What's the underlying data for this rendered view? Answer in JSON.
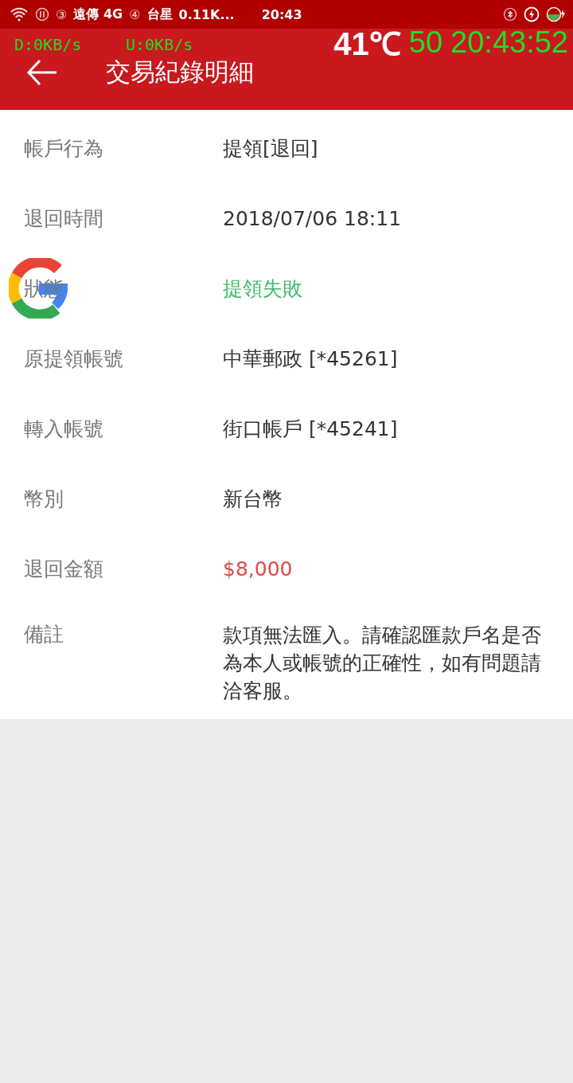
{
  "status_bar": {
    "sim1": "③",
    "carrier1": "遠傳 4G",
    "sim2": "④",
    "carrier2": "台星",
    "speed": "0.11K...",
    "time": "20:43"
  },
  "overlay": {
    "download": "D:0KB/s",
    "upload": "U:0KB/s",
    "temperature": "41℃",
    "fps": "50",
    "clock": "20:43:52"
  },
  "app_bar": {
    "title": "交易紀錄明細"
  },
  "details": [
    {
      "label": "帳戶行為",
      "value": "提領[退回]",
      "kind": "plain"
    },
    {
      "label": "退回時間",
      "value": "2018/07/06 18:11",
      "kind": "plain"
    },
    {
      "label": "狀態",
      "value": "提領失敗",
      "kind": "status"
    },
    {
      "label": "原提領帳號",
      "value": "中華郵政 [*45261]",
      "kind": "plain"
    },
    {
      "label": "轉入帳號",
      "value": "街口帳戶 [*45241]",
      "kind": "plain"
    },
    {
      "label": "幣別",
      "value": "新台幣",
      "kind": "plain"
    },
    {
      "label": "退回金額",
      "value": "$8,000",
      "kind": "amount"
    },
    {
      "label": "備註",
      "value": "款項無法匯入。請確認匯款戶名是否為本人或帳號的正確性，如有問題請洽客服。",
      "kind": "plain"
    }
  ]
}
